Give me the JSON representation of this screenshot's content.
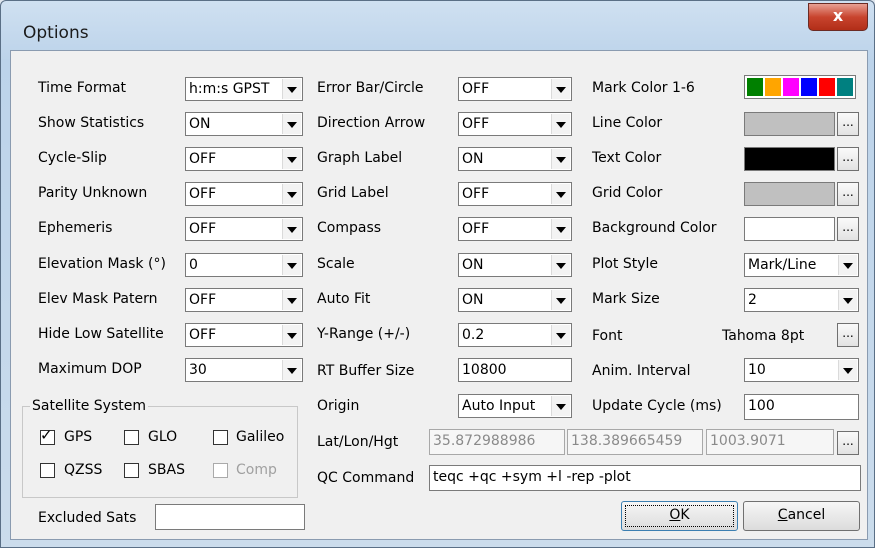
{
  "window": {
    "title": "Options",
    "close_label": "x"
  },
  "col1": {
    "rows": [
      {
        "label": "Time Format",
        "value": "h:m:s GPST"
      },
      {
        "label": "Show Statistics",
        "value": "ON"
      },
      {
        "label": "Cycle-Slip",
        "value": "OFF"
      },
      {
        "label": "Parity Unknown",
        "value": "OFF"
      },
      {
        "label": "Ephemeris",
        "value": "OFF"
      },
      {
        "label": "Elevation Mask (°)",
        "value": "0"
      },
      {
        "label": "Elev Mask Patern",
        "value": "OFF"
      },
      {
        "label": "Hide Low Satellite",
        "value": "OFF"
      },
      {
        "label": "Maximum DOP",
        "value": "30"
      }
    ]
  },
  "col2": {
    "rows": [
      {
        "label": "Error Bar/Circle",
        "value": "OFF"
      },
      {
        "label": "Direction Arrow",
        "value": "OFF"
      },
      {
        "label": "Graph Label",
        "value": "ON"
      },
      {
        "label": "Grid Label",
        "value": "OFF"
      },
      {
        "label": "Compass",
        "value": "OFF"
      },
      {
        "label": "Scale",
        "value": "ON"
      },
      {
        "label": "Auto Fit",
        "value": "ON"
      },
      {
        "label": "Y-Range (+/-)",
        "value": "0.2"
      },
      {
        "label": "RT Buffer Size",
        "value": "10800"
      },
      {
        "label": "Origin",
        "value": "Auto Input"
      }
    ]
  },
  "col3": {
    "mark_color": {
      "label": "Mark Color 1-6",
      "colors": [
        "#008000",
        "#ffa500",
        "#ff00ff",
        "#0000ff",
        "#ff0000",
        "#008080"
      ]
    },
    "line_color": {
      "label": "Line Color",
      "color": "#c0c0c0"
    },
    "text_color": {
      "label": "Text Color",
      "color": "#000000"
    },
    "grid_color": {
      "label": "Grid Color",
      "color": "#c0c0c0"
    },
    "background_color": {
      "label": "Background Color",
      "color": "#ffffff"
    },
    "plot_style": {
      "label": "Plot Style",
      "value": "Mark/Line"
    },
    "mark_size": {
      "label": "Mark Size",
      "value": "2"
    },
    "font": {
      "label": "Font",
      "value": "Tahoma 8pt"
    },
    "anim_interval": {
      "label": "Anim. Interval",
      "value": "10"
    },
    "update_cycle": {
      "label": "Update Cycle (ms)",
      "value": "100"
    },
    "dots_label": "..."
  },
  "satellite_system": {
    "title": "Satellite System",
    "items": [
      {
        "label": "GPS",
        "checked": true,
        "enabled": true
      },
      {
        "label": "GLO",
        "checked": false,
        "enabled": true
      },
      {
        "label": "Galileo",
        "checked": false,
        "enabled": true
      },
      {
        "label": "QZSS",
        "checked": false,
        "enabled": true
      },
      {
        "label": "SBAS",
        "checked": false,
        "enabled": true
      },
      {
        "label": "Comp",
        "checked": false,
        "enabled": false
      }
    ]
  },
  "excluded_sats": {
    "label": "Excluded Sats",
    "value": ""
  },
  "latlonhgt": {
    "label": "Lat/Lon/Hgt",
    "lat": "35.872988986",
    "lon": "138.389665459",
    "hgt": "1003.9071"
  },
  "qc_command": {
    "label": "QC Command",
    "value": "teqc +qc +sym +l -rep -plot"
  },
  "buttons": {
    "ok_label": "OK",
    "ok_underline": "O",
    "ok_rest": "K",
    "cancel_underline": "C",
    "cancel_rest": "ancel"
  },
  "checkmark": "✓"
}
